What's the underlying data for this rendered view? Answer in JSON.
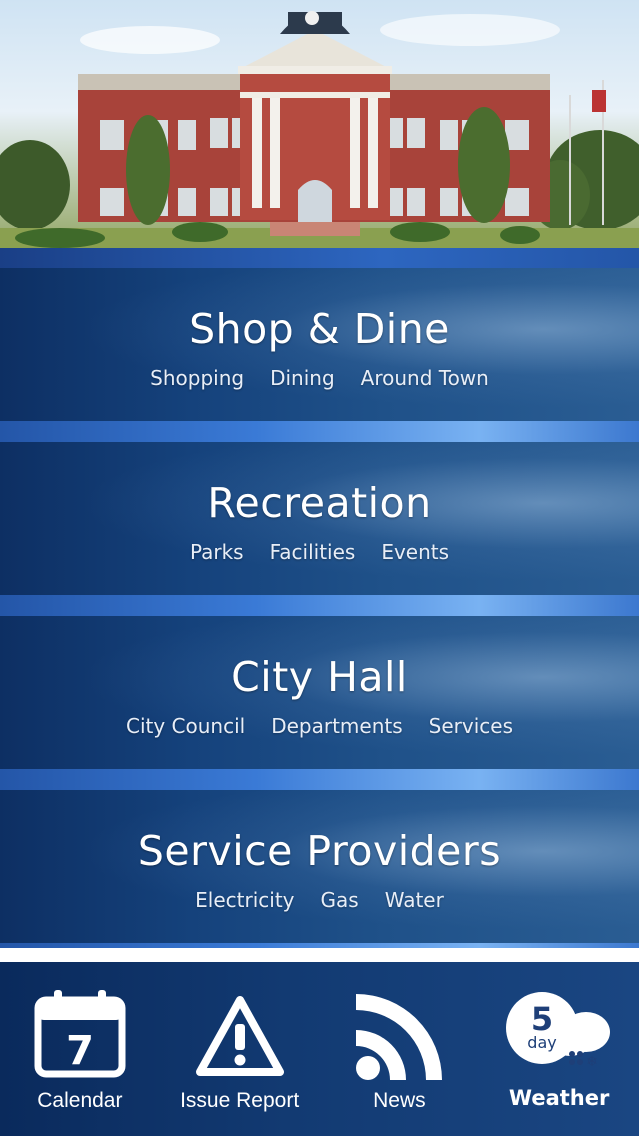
{
  "menu": [
    {
      "title": "Shop & Dine",
      "links": [
        "Shopping",
        "Dining",
        "Around Town"
      ]
    },
    {
      "title": "Recreation",
      "links": [
        "Parks",
        "Facilities",
        "Events"
      ]
    },
    {
      "title": "City Hall",
      "links": [
        "City Council",
        "Departments",
        "Services"
      ]
    },
    {
      "title": "Service Providers",
      "links": [
        "Electricity",
        "Gas",
        "Water"
      ]
    }
  ],
  "toolbar": {
    "calendar": {
      "label": "Calendar",
      "day": "7"
    },
    "issue_report": {
      "label": "Issue Report"
    },
    "news": {
      "label": "News"
    },
    "weather": {
      "label": "Weather",
      "badge_number": "5",
      "badge_text": "day"
    }
  },
  "colors": {
    "tile_dark": "#0d2f63",
    "tile_light": "#2a5d93",
    "band_accent": "#79b2f2",
    "toolbar": "#123a72"
  },
  "icons": [
    "calendar-icon",
    "warning-icon",
    "rss-icon",
    "weather-icon"
  ]
}
